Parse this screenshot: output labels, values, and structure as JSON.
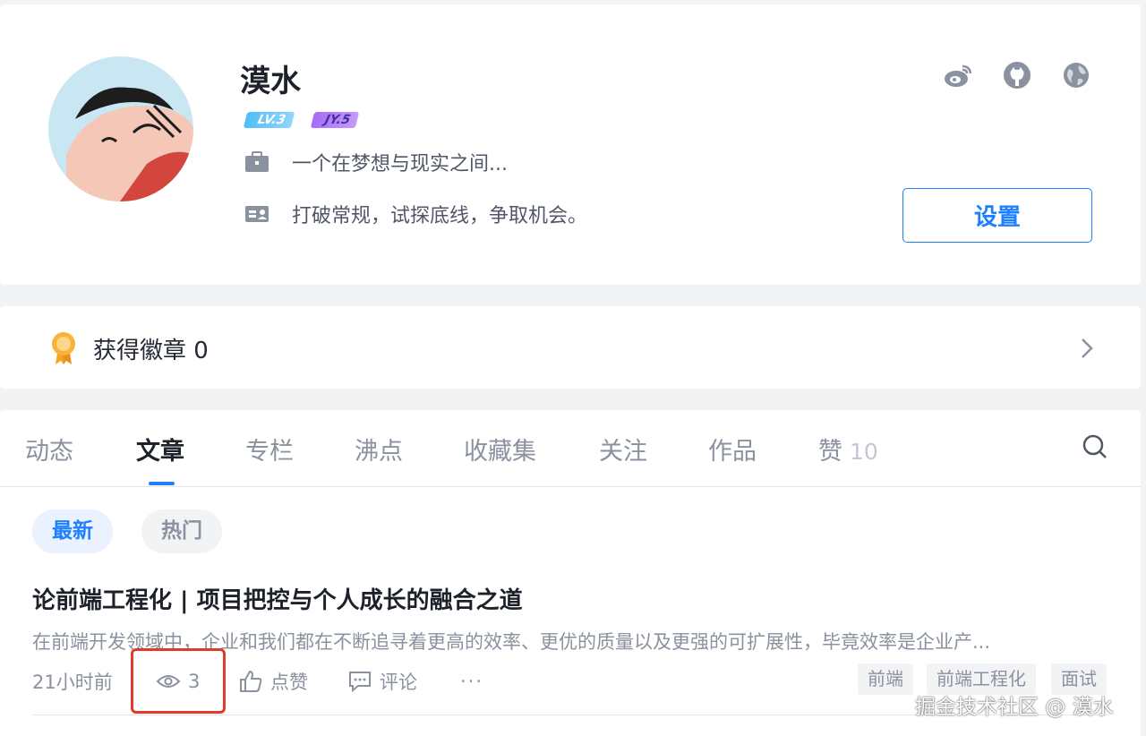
{
  "profile": {
    "username": "漠水",
    "level_badges": [
      {
        "label": "LV.3",
        "icon": "level-icon"
      },
      {
        "label": "JY.5",
        "icon": "jy-icon"
      }
    ],
    "position": "一个在梦想与现实之间...",
    "bio": "打破常规，试探底线，争取机会。",
    "social_icons": [
      "weibo-icon",
      "github-icon",
      "globe-icon"
    ],
    "settings_label": "设置"
  },
  "badges": {
    "label": "获得徽章 0"
  },
  "tabs": [
    {
      "label": "动态"
    },
    {
      "label": "文章",
      "active": true
    },
    {
      "label": "专栏"
    },
    {
      "label": "沸点"
    },
    {
      "label": "收藏集"
    },
    {
      "label": "关注"
    },
    {
      "label": "作品"
    },
    {
      "label": "赞",
      "count": "10"
    }
  ],
  "filters": {
    "latest": "最新",
    "hot": "热门"
  },
  "article": {
    "title": "论前端工程化 | 项目把控与个人成长的融合之道",
    "abstract": "在前端开发领域中，企业和我们都在不断追寻着更高的效率、更优的质量以及更强的可扩展性，毕竟效率是企业产...",
    "time": "21小时前",
    "views": "3",
    "like_label": "点赞",
    "comment_label": "评论",
    "more": "···",
    "tags": [
      "前端",
      "前端工程化",
      "面试"
    ]
  },
  "watermark": "掘金技术社区 @ 漠水",
  "colors": {
    "accent": "#1e80ff",
    "highlight": "#e03b2a"
  }
}
